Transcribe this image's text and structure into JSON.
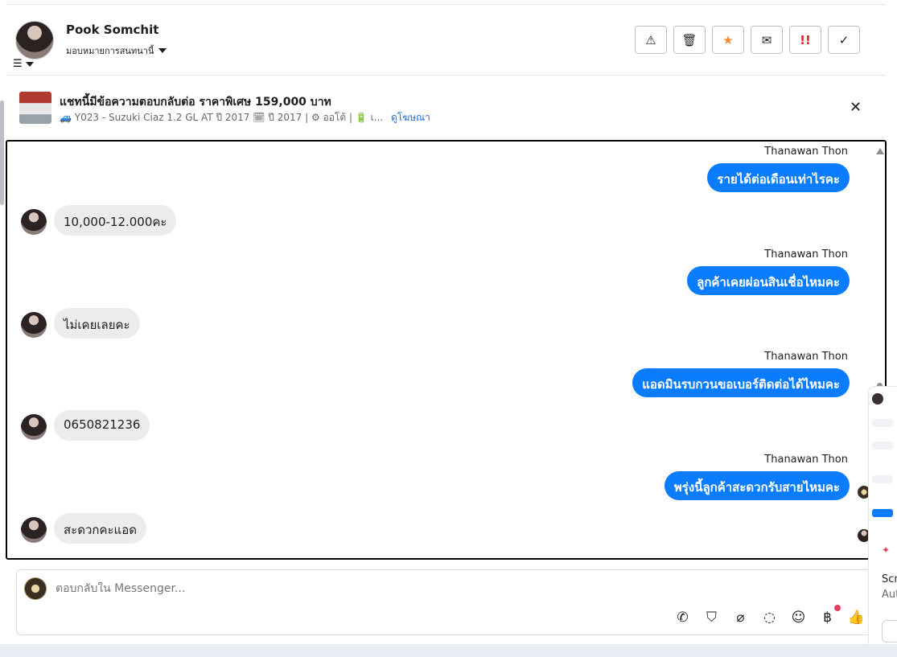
{
  "header": {
    "name": "Pook Somchit",
    "assign_label": "มอบหมายการสนทนานี้",
    "actions": [
      {
        "name": "report-spam-button",
        "icon": "⚠"
      },
      {
        "name": "delete-button",
        "icon": "🗑"
      },
      {
        "name": "star-button",
        "icon": "★"
      },
      {
        "name": "mark-unread-button",
        "icon": "✉"
      },
      {
        "name": "follow-up-button",
        "icon": "!!"
      },
      {
        "name": "mark-done-button",
        "icon": "✓"
      }
    ]
  },
  "ad": {
    "title": "แชทนี้มีข้อความตอบกลับต่อ ราคาพิเศษ 159,000 บาท",
    "subtitle": "🚙 Y023 - Suzuki Ciaz 1.2 GL AT ปี 2017 🗓 ปี 2017 | ⚙ ออโต้ | 🔋 เ...",
    "link": "ดูโฆษณา"
  },
  "messages": [
    {
      "dir": "out",
      "sender": "Thanawan Thon",
      "text": "รายได้ต่อเดือนเท่าไรคะ"
    },
    {
      "dir": "in",
      "text": "10,000-12.000คะ"
    },
    {
      "dir": "out",
      "sender": "Thanawan Thon",
      "text": "ลูกค้าเคยผ่อนสินเชื่อไหมคะ"
    },
    {
      "dir": "in",
      "text": "ไม่เคยเลยคะ"
    },
    {
      "dir": "out",
      "sender": "Thanawan Thon",
      "text": "แอดมินรบกวนขอเบอร์ติดต่อได้ไหมคะ"
    },
    {
      "dir": "in",
      "text": "0650821236"
    },
    {
      "dir": "out",
      "sender": "Thanawan Thon",
      "text": "พรุ่งนี้ลูกค้าสะดวกรับสายไหมคะ"
    },
    {
      "dir": "in",
      "text": "สะดวกคะแอด"
    }
  ],
  "composer": {
    "placeholder": "ตอบกลับใน Messenger...",
    "tools": [
      "call-icon",
      "bag-icon",
      "attach-icon",
      "chat-icon",
      "emoji-icon",
      "baht-icon",
      "like-icon"
    ]
  },
  "overlay": {
    "line1": "Scr",
    "line2": "Aut"
  }
}
